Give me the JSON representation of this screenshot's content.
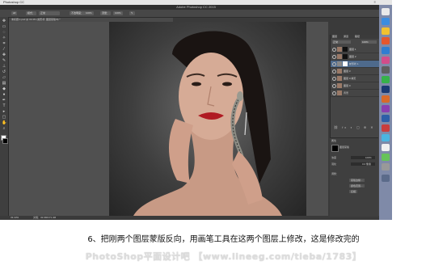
{
  "menubar": {
    "app_name": "Photoshop CC",
    "right_text": "≡"
  },
  "window": {
    "title": "Adobe Photoshop CC 2015"
  },
  "options_bar": {
    "mode_label": "模式：",
    "mode_value": "正常",
    "opacity_label": "不透明度：",
    "opacity_value": "100%",
    "flow_label": "流量：",
    "flow_value": "100%"
  },
  "document": {
    "tab_label": "未标题-1.psd @ 33.3% (蛇形状, 图层蒙版/8) *"
  },
  "status": {
    "zoom": "33.33%",
    "doc_info": "文档：32.9M/171.4M"
  },
  "layers_panel": {
    "tabs": [
      "图层",
      "通道",
      "路径"
    ],
    "blend_mode": "正常",
    "opacity": "100%",
    "layers": [
      {
        "name": "图层 1"
      },
      {
        "name": "图层 2"
      },
      {
        "name": "蛇形状 1"
      },
      {
        "name": "图层 3"
      },
      {
        "name": "图层 0 拷贝"
      },
      {
        "name": "图层 0"
      },
      {
        "name": "背景"
      }
    ]
  },
  "properties_panel": {
    "title": "属性",
    "mask_label": "图层蒙版",
    "density_label": "浓度",
    "density_value": "100%",
    "feather_label": "羽化",
    "feather_value": "0.0 像素",
    "refine_label": "调整：",
    "button1": "蒙版边缘...",
    "button2": "颜色范围...",
    "button3": "反相"
  },
  "caption": "6、把刚两个图层蒙版反向，用画笔工具在这两个图层上修改，这是修改完的",
  "watermark": "PhotoShop平面设计吧 【www.lineeg.com/tieba/1783】",
  "colors": {
    "ps_bg": "#3a3a3a",
    "panel_bg": "#454545",
    "selected_layer": "#4e6a8c",
    "lips": "#b01a22",
    "dock": "#7f8aa8"
  }
}
